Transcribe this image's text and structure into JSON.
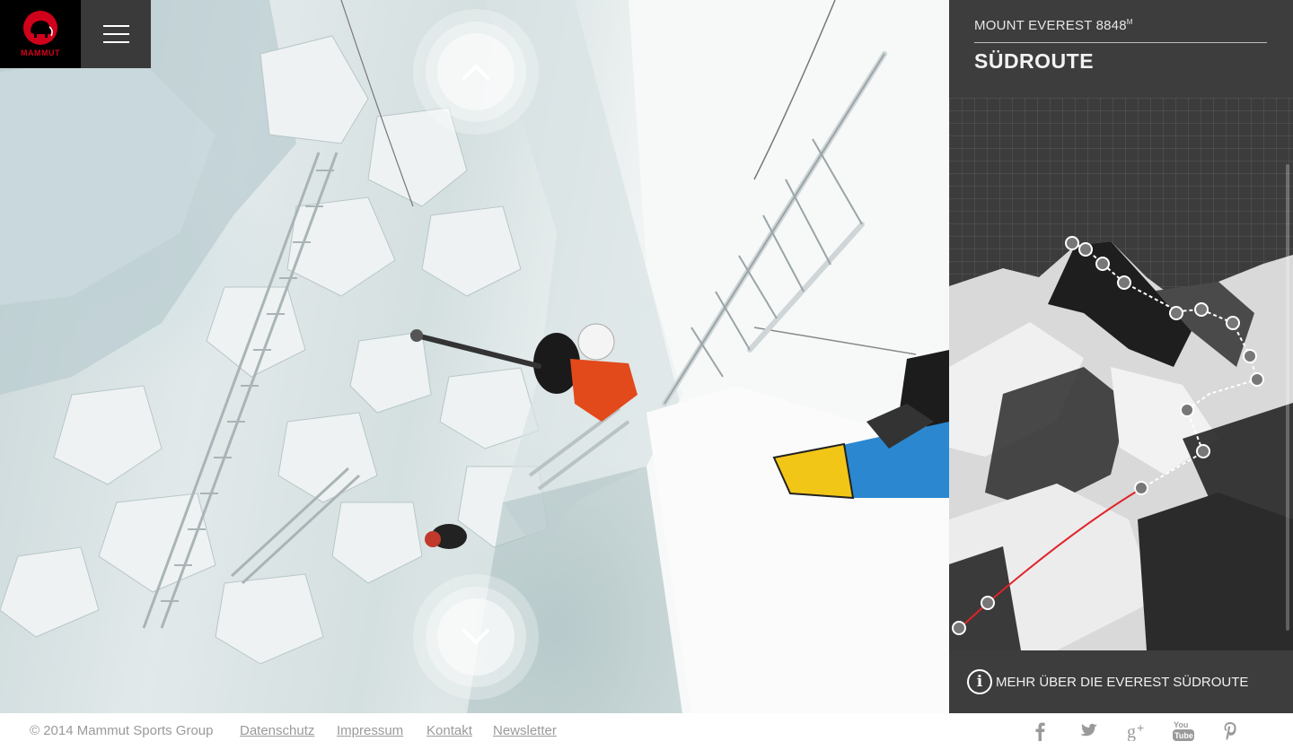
{
  "brand": {
    "name": "MAMMUT"
  },
  "nav": {
    "menu_icon": "hamburger-icon",
    "up_icon": "chevron-up-icon",
    "down_icon": "chevron-down-icon"
  },
  "panel": {
    "mountain": "MOUNT EVEREST 8848",
    "mountain_unit": "M",
    "route": "SÜDROUTE",
    "info_label": "MEHR ÜBER DIE EVEREST SÜDROUTE",
    "info_icon": "info-icon"
  },
  "footer": {
    "copyright": "© 2014 Mammut Sports Group",
    "links": [
      "Datenschutz",
      "Impressum",
      "Kontakt",
      "Newsletter"
    ],
    "social": [
      "facebook-icon",
      "twitter-icon",
      "google-plus-icon",
      "youtube-icon",
      "pinterest-icon"
    ]
  },
  "colors": {
    "brand_red": "#d0021b",
    "route_red": "#e0242a"
  }
}
